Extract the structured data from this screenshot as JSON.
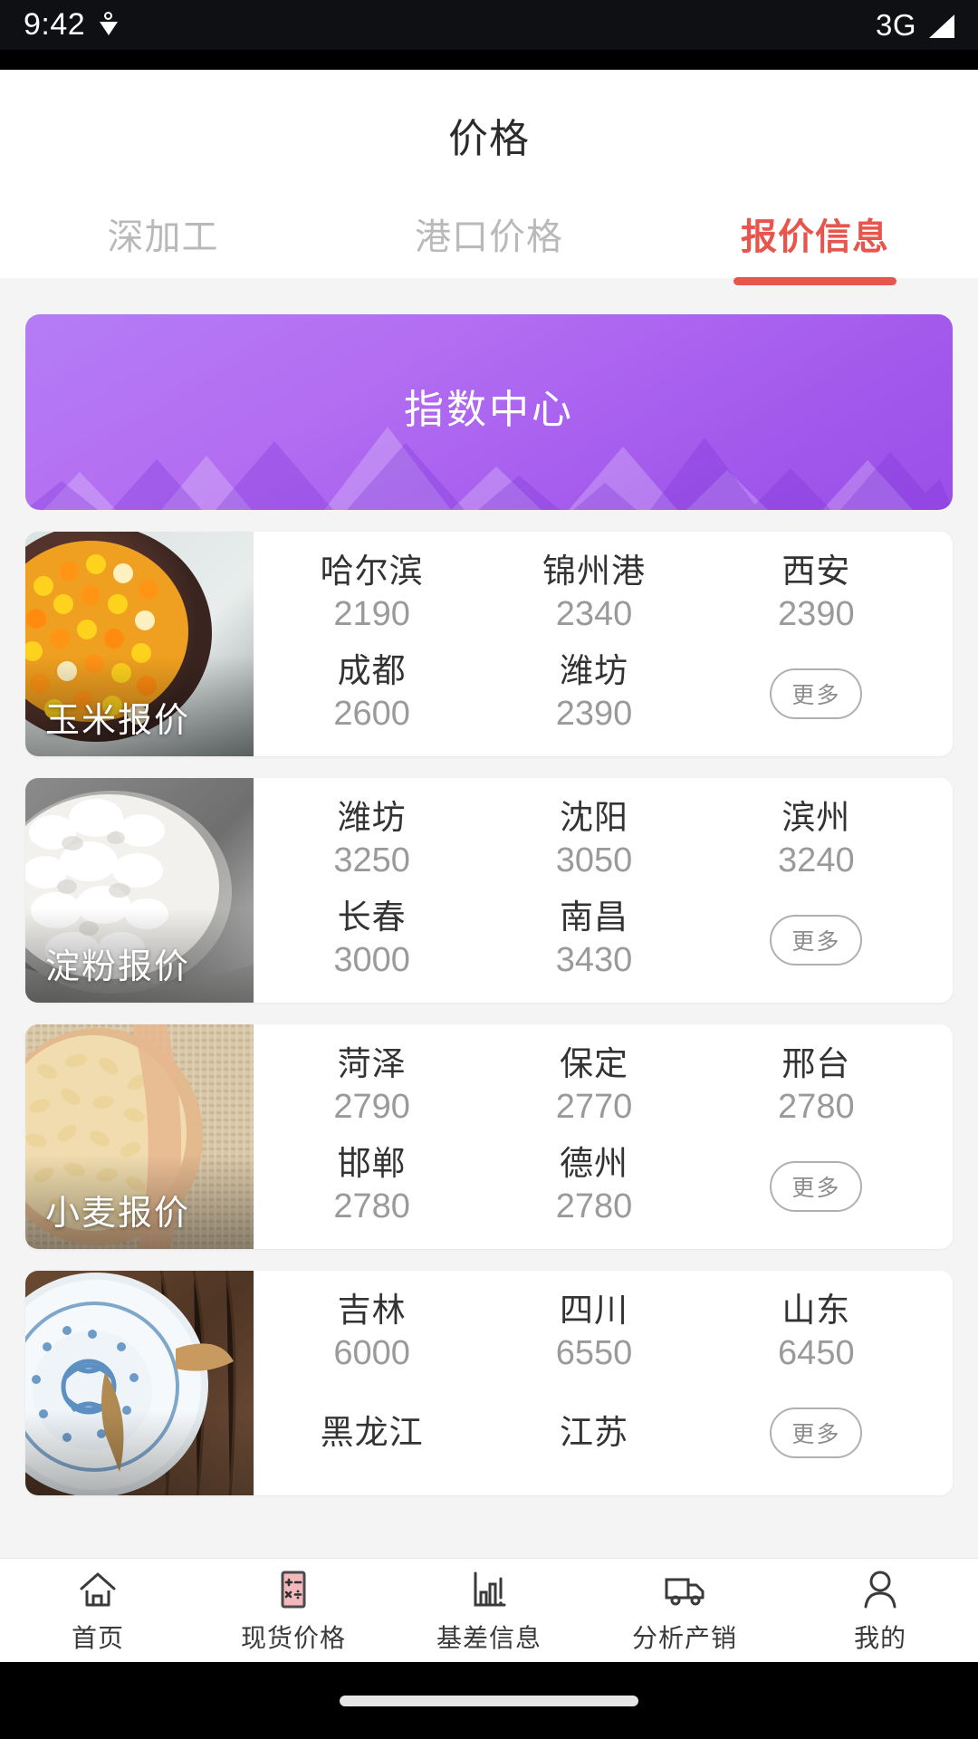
{
  "status_bar": {
    "time": "9:42",
    "location_icon": "location-pin-icon",
    "network": "3G",
    "signal_icon": "signal-bars-icon"
  },
  "header": {
    "title": "价格",
    "tabs": [
      {
        "label": "深加工",
        "active": false
      },
      {
        "label": "港口价格",
        "active": false
      },
      {
        "label": "报价信息",
        "active": true
      }
    ],
    "active_color": "#e8554d",
    "inactive_color": "#b9b9b9"
  },
  "banner": {
    "title": "指数中心",
    "gradient_from": "#b57cf5",
    "gradient_to": "#9b4fe8"
  },
  "cards": [
    {
      "title": "玉米报价",
      "thumb": "corn-photo",
      "more_label": "更多",
      "quotes": [
        {
          "city": "哈尔滨",
          "price": "2190"
        },
        {
          "city": "锦州港",
          "price": "2340"
        },
        {
          "city": "西安",
          "price": "2390"
        },
        {
          "city": "成都",
          "price": "2600"
        },
        {
          "city": "潍坊",
          "price": "2390"
        }
      ]
    },
    {
      "title": "淀粉报价",
      "thumb": "starch-photo",
      "more_label": "更多",
      "quotes": [
        {
          "city": "潍坊",
          "price": "3250"
        },
        {
          "city": "沈阳",
          "price": "3050"
        },
        {
          "city": "滨州",
          "price": "3240"
        },
        {
          "city": "长春",
          "price": "3000"
        },
        {
          "city": "南昌",
          "price": "3430"
        }
      ]
    },
    {
      "title": "小麦报价",
      "thumb": "wheat-photo",
      "more_label": "更多",
      "quotes": [
        {
          "city": "菏泽",
          "price": "2790"
        },
        {
          "city": "保定",
          "price": "2770"
        },
        {
          "city": "邢台",
          "price": "2780"
        },
        {
          "city": "邯郸",
          "price": "2780"
        },
        {
          "city": "德州",
          "price": "2780"
        }
      ]
    },
    {
      "title": "",
      "thumb": "bowl-photo",
      "more_label": "更多",
      "quotes": [
        {
          "city": "吉林",
          "price": "6000"
        },
        {
          "city": "四川",
          "price": "6550"
        },
        {
          "city": "山东",
          "price": "6450"
        },
        {
          "city": "黑龙江",
          "price": ""
        },
        {
          "city": "江苏",
          "price": ""
        }
      ]
    }
  ],
  "bottom_nav": [
    {
      "label": "首页",
      "icon": "home-icon",
      "active": false
    },
    {
      "label": "现货价格",
      "icon": "calculator-icon",
      "active": true
    },
    {
      "label": "基差信息",
      "icon": "bar-chart-icon",
      "active": false
    },
    {
      "label": "分析产销",
      "icon": "truck-icon",
      "active": false
    },
    {
      "label": "我的",
      "icon": "person-icon",
      "active": false
    }
  ],
  "nav_active_color": "#f3b8bb"
}
